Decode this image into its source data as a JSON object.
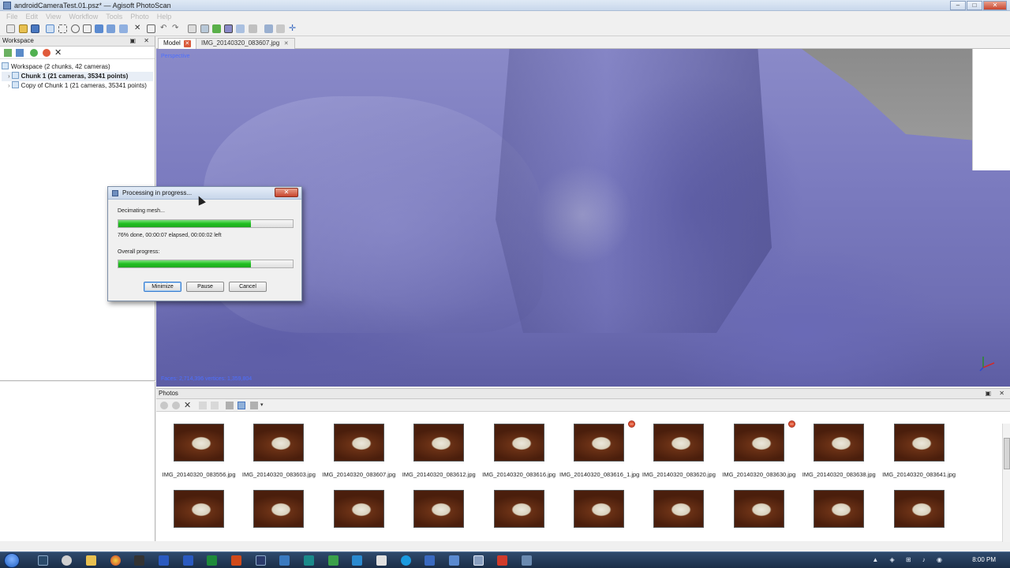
{
  "window": {
    "title": "androidCameraTest.01.psz* — Agisoft PhotoScan",
    "controls": {
      "minimize": "–",
      "maximize": "□",
      "close": "✕"
    }
  },
  "menu": [
    "File",
    "Edit",
    "View",
    "Workflow",
    "Tools",
    "Photo",
    "Help"
  ],
  "workspace": {
    "header": "Workspace",
    "header_controls": "▣ ✕",
    "tree": [
      {
        "label": "Workspace (2 chunks, 42 cameras)",
        "bold": false
      },
      {
        "label": "Chunk 1 (21 cameras, 35341 points)",
        "bold": true
      },
      {
        "label": "Copy of Chunk 1 (21 cameras, 35341 points)",
        "bold": false
      }
    ]
  },
  "tabs": [
    {
      "label": "Model",
      "close": "✕"
    },
    {
      "label": "IMG_20140320_083607.jpg",
      "close": "✕"
    }
  ],
  "viewport": {
    "projection": "Perspective",
    "stats": "Faces: 2,714,396 vertices: 1,359,804"
  },
  "dialog": {
    "title": "Processing in progress...",
    "close": "✕",
    "task_label": "Decimating mesh...",
    "task_progress": 0.76,
    "task_status": "76% done, 00:00:07 elapsed, 00:00:02 left",
    "overall_label": "Overall progress:",
    "overall_progress": 0.76,
    "buttons": {
      "minimize": "Minimize",
      "pause": "Pause",
      "cancel": "Cancel"
    }
  },
  "photos": {
    "header": "Photos",
    "header_controls": "▣ ✕",
    "row1": [
      {
        "label": "IMG_20140320_083556.jpg",
        "disabled": false
      },
      {
        "label": "IMG_20140320_083603.jpg",
        "disabled": false
      },
      {
        "label": "IMG_20140320_083607.jpg",
        "disabled": false
      },
      {
        "label": "IMG_20140320_083612.jpg",
        "disabled": false
      },
      {
        "label": "IMG_20140320_083616.jpg",
        "disabled": false
      },
      {
        "label": "IMG_20140320_083616_1.jpg",
        "disabled": true
      },
      {
        "label": "IMG_20140320_083620.jpg",
        "disabled": false
      },
      {
        "label": "IMG_20140320_083630.jpg",
        "disabled": true
      },
      {
        "label": "IMG_20140320_083638.jpg",
        "disabled": false
      },
      {
        "label": "IMG_20140320_083641.jpg",
        "disabled": false
      }
    ],
    "row2_count": 10
  },
  "taskbar": {
    "clock": "8:00 PM",
    "tray": "▲ ◈ ⊞ ♪ ◉"
  },
  "colors": {
    "mesh": "#7b7bbf",
    "progress_green": "#1fbf1f",
    "stats_text": "#4c6fff",
    "close_red": "#c8452e"
  }
}
